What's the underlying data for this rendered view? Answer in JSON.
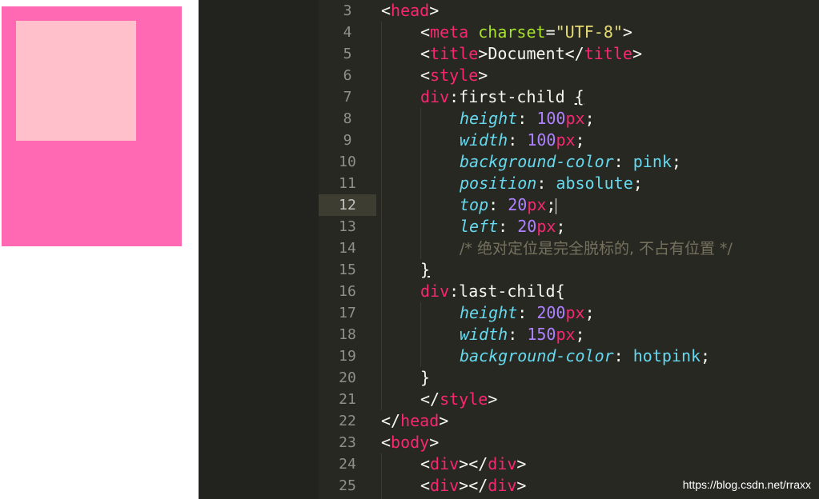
{
  "preview": {
    "outer_color": "#ff69b4",
    "inner_color": "#ffc0cb"
  },
  "editor": {
    "active_line": 12,
    "line_numbers": [
      "3",
      "4",
      "5",
      "6",
      "7",
      "8",
      "9",
      "10",
      "11",
      "12",
      "13",
      "14",
      "15",
      "16",
      "17",
      "18",
      "19",
      "20",
      "21",
      "22",
      "23",
      "24",
      "25"
    ],
    "tokens": {
      "l3_tag": "head",
      "l4_tag": "meta",
      "l4_attr": "charset",
      "l4_str": "\"UTF-8\"",
      "l5_tag_open": "title",
      "l5_text": "Document",
      "l5_tag_close": "title",
      "l6_tag": "style",
      "l7_sel": "div",
      "l7_pseudo": ":first-child ",
      "l7_brace": "{",
      "l8_prop": "height",
      "l8_num": "100",
      "l8_unit": "px",
      "l9_prop": "width",
      "l9_num": "100",
      "l9_unit": "px",
      "l10_prop": "background-color",
      "l10_val": "pink",
      "l11_prop": "position",
      "l11_val": "absolute",
      "l12_prop": "top",
      "l12_num": "20",
      "l12_unit": "px",
      "l13_prop": "left",
      "l13_num": "20",
      "l13_unit": "px",
      "l14_comment": "/* 绝对定位是完全脱标的, 不占有位置 */",
      "l15_brace": "}",
      "l16_sel": "div",
      "l16_pseudo": ":last-child{",
      "l17_prop": "height",
      "l17_num": "200",
      "l17_unit": "px",
      "l18_prop": "width",
      "l18_num": "150",
      "l18_unit": "px",
      "l19_prop": "background-color",
      "l19_val": "hotpink",
      "l20_brace": "}",
      "l21_tag": "style",
      "l22_tag": "head",
      "l23_tag": "body",
      "l24_tag_open": "div",
      "l24_tag_close": "div",
      "l25_tag_open": "div",
      "l25_tag_close": "div"
    }
  },
  "watermark": "https://blog.csdn.net/rraxx"
}
